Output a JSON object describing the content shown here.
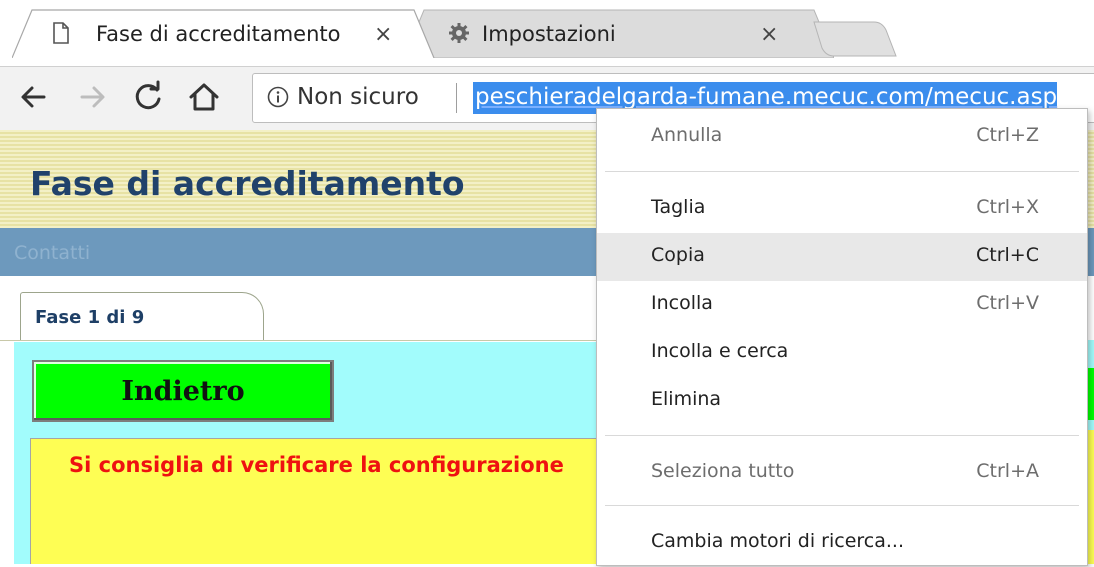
{
  "browser": {
    "tabs": [
      {
        "title": "Fase di accreditamento",
        "close": "×",
        "icon": "page-icon",
        "active": true
      },
      {
        "title": "Impostazioni",
        "close": "×",
        "icon": "gear-icon",
        "active": false
      }
    ],
    "toolbar": {
      "security_label": "Non sicuro",
      "url": "peschieradelgarda-fumane.mecuc.com/mecuc.asp"
    }
  },
  "page": {
    "title": "Fase di accreditamento",
    "nav_link": "Contatti",
    "phase_tab": "Fase 1 di 9",
    "back_button": "Indietro",
    "warning": "Si consiglia di verificare la configurazione"
  },
  "context_menu": {
    "items": [
      {
        "label": "Annulla",
        "shortcut": "Ctrl+Z",
        "enabled": false
      },
      {
        "label": "Taglia",
        "shortcut": "Ctrl+X",
        "enabled": false
      },
      {
        "label": "Copia",
        "shortcut": "Ctrl+C",
        "enabled": true,
        "highlighted": true
      },
      {
        "label": "Incolla",
        "shortcut": "Ctrl+V",
        "enabled": false
      },
      {
        "label": "Incolla e cerca",
        "shortcut": "",
        "enabled": true
      },
      {
        "label": "Elimina",
        "shortcut": "",
        "enabled": true
      },
      {
        "label": "Seleziona tutto",
        "shortcut": "Ctrl+A",
        "enabled": false
      },
      {
        "label": "Cambia motori di ricerca...",
        "shortcut": "",
        "enabled": true
      }
    ]
  },
  "colors": {
    "accent_selection": "#3b8ded",
    "page_title": "#20426b",
    "nav_band": "#6d99bd",
    "back_button": "#00ff00",
    "content_bg": "#a2fcfc",
    "warning_bg": "#fefe54",
    "warning_text": "#ee1111"
  }
}
